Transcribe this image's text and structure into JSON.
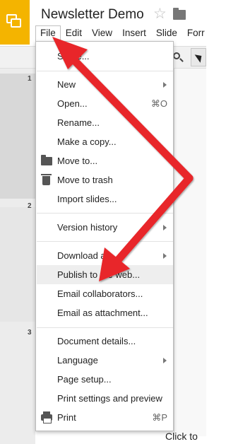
{
  "app": {
    "doc_title": "Newsletter Demo",
    "colors": {
      "brand": "#f4b400",
      "annotation": "#e8262a",
      "highlight": "#eeeeee"
    }
  },
  "menubar": {
    "items": [
      {
        "label": "File",
        "active": true
      },
      {
        "label": "Edit"
      },
      {
        "label": "View"
      },
      {
        "label": "Insert"
      },
      {
        "label": "Slide"
      },
      {
        "label": "Forr"
      }
    ]
  },
  "filmstrip": {
    "slide_numbers": [
      "1",
      "2",
      "3"
    ]
  },
  "canvas": {
    "placeholder": "Click to"
  },
  "file_menu": {
    "share": {
      "label": "Share..."
    },
    "new": {
      "label": "New",
      "submenu": true
    },
    "open": {
      "label": "Open...",
      "shortcut": "⌘O"
    },
    "rename": {
      "label": "Rename..."
    },
    "make_copy": {
      "label": "Make a copy..."
    },
    "move_to": {
      "label": "Move to...",
      "icon": "folder-icon"
    },
    "move_trash": {
      "label": "Move to trash",
      "icon": "trash-icon"
    },
    "import_slides": {
      "label": "Import slides..."
    },
    "version_history": {
      "label": "Version history",
      "submenu": true
    },
    "download_as": {
      "label": "Download as",
      "submenu": true
    },
    "publish": {
      "label": "Publish to the web...",
      "highlighted": true
    },
    "email_collab": {
      "label": "Email collaborators..."
    },
    "email_attach": {
      "label": "Email as attachment..."
    },
    "doc_details": {
      "label": "Document details..."
    },
    "language": {
      "label": "Language",
      "submenu": true
    },
    "page_setup": {
      "label": "Page setup..."
    },
    "print_settings": {
      "label": "Print settings and preview"
    },
    "print": {
      "label": "Print",
      "shortcut": "⌘P",
      "icon": "printer-icon"
    }
  }
}
